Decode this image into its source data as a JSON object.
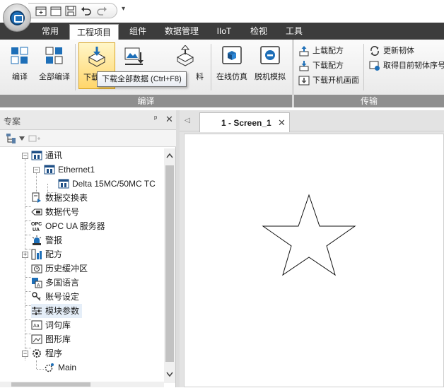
{
  "quick_access": {
    "dropdown_glyph": "▾"
  },
  "ribbon_tabs": [
    {
      "label": "常用"
    },
    {
      "label": "工程项目"
    },
    {
      "label": "组件"
    },
    {
      "label": "数据管理"
    },
    {
      "label": "IIoT"
    },
    {
      "label": "检视"
    },
    {
      "label": "工具"
    }
  ],
  "ribbon": {
    "groups": [
      {
        "label": "编译"
      },
      {
        "label": "传输"
      }
    ],
    "buttons": {
      "compile": "编译",
      "compile_all": "全部编译",
      "download_all_partial": "下载",
      "extra_partial": "料",
      "online_sim": "在线仿真",
      "offline_sim": "脱机模拟",
      "upload_recipe": "上载配方",
      "download_recipe": "下载配方",
      "download_boot_screen": "下载开机画面",
      "update_firmware": "更新韧体",
      "get_firmware_seq": "取得目前韧体序号"
    },
    "tooltip": "下载全部数据 (Ctrl+F8)"
  },
  "project_panel": {
    "title": "专案",
    "pin_glyph": "ᵖ",
    "close_glyph": "✕",
    "tree": [
      {
        "label": "通讯"
      },
      {
        "label": "Ethernet1"
      },
      {
        "label": "Delta 15MC/50MC TC"
      },
      {
        "label": "数据交换表"
      },
      {
        "label": "数据代号"
      },
      {
        "label": "OPC UA 服务器"
      },
      {
        "label": "警报"
      },
      {
        "label": "配方"
      },
      {
        "label": "历史缓冲区"
      },
      {
        "label": "多国语言"
      },
      {
        "label": "账号设定"
      },
      {
        "label": "模块参数"
      },
      {
        "label": "词句库"
      },
      {
        "label": "图形库"
      },
      {
        "label": "程序"
      },
      {
        "label": "Main"
      }
    ]
  },
  "editor": {
    "tab_label": "1 - Screen_1",
    "tab_close": "✕",
    "nav_glyph": "◁"
  },
  "colors": {
    "ribbon_bar": "#3c3c3c",
    "group_label_bg": "#8f8f8f",
    "pressed_button": "#ffd66b",
    "accent_blue": "#1e6fb8"
  }
}
